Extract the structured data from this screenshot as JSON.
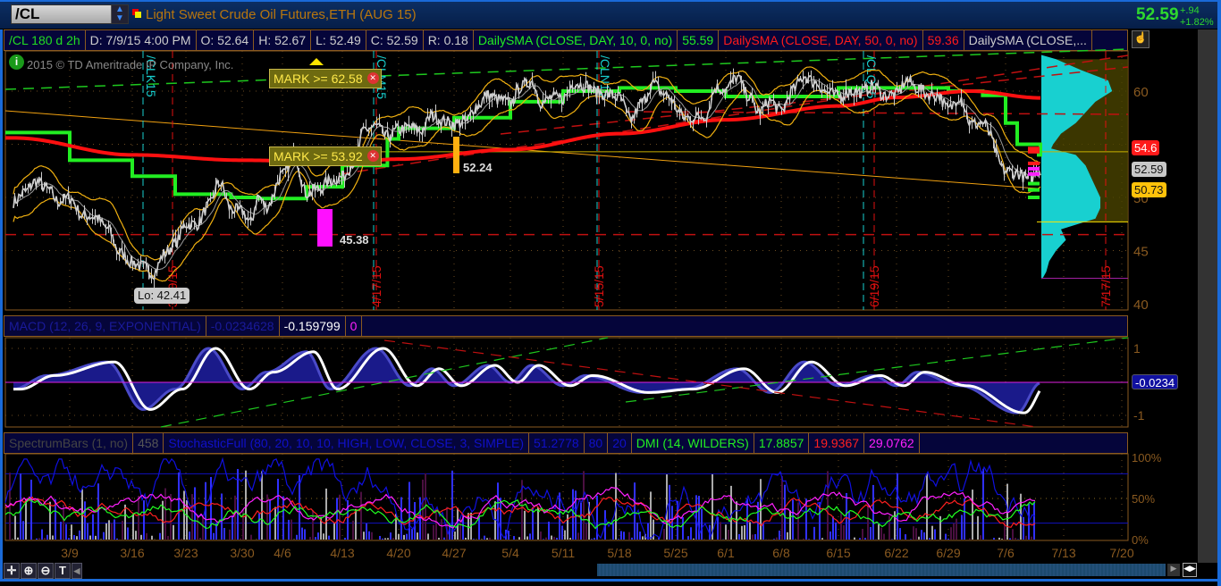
{
  "header": {
    "symbol": "/CL",
    "description": "Light Sweet Crude Oil Futures,ETH (AUG 15)",
    "last": "52.59",
    "change": "+.94",
    "change_pct": "+1.82%"
  },
  "study_row": {
    "aggregation": "/CL 180 d 2h",
    "date": "D: 7/9/15 4:00 PM",
    "open": "O: 52.64",
    "high": "H: 52.67",
    "low": "L: 52.49",
    "close": "C: 52.59",
    "range": "R: 0.18",
    "sma10_label": "DailySMA (CLOSE, DAY, 10, 0, no)",
    "sma10_value": "55.59",
    "sma50_label": "DailySMA (CLOSE, DAY, 50, 0, no)",
    "sma50_value": "59.36",
    "sma3_label": "DailySMA (CLOSE,..."
  },
  "copyright": "2015 © TD Ameritrade IP Company, Inc.",
  "alerts": [
    {
      "label": "MARK >= 62.58"
    },
    {
      "label": "MARK >= 53.92"
    }
  ],
  "annotations": {
    "low_label": "Lo: 42.41",
    "magenta_value": "45.38",
    "orange_value": "52.24"
  },
  "price_labels": [
    {
      "value": "54.6",
      "color": "#ff1a1a"
    },
    {
      "value": "52.59",
      "color": "#c8c8c8"
    },
    {
      "value": "50.73",
      "color": "#ffc20a"
    }
  ],
  "macd_header": {
    "label": "MACD (12, 26, 9, EXPONENTIAL)",
    "value": "-0.0234628",
    "avg": "-0.159799",
    "diff": "0",
    "last_label": "-0.0234"
  },
  "lower_header": {
    "spectrum": "SpectrumBars (1, no)",
    "spectrum_value": "458",
    "stoch": "StochasticFull (80, 20, 10, 10, HIGH, LOW, CLOSE, 3, SIMPLE)",
    "stoch_value": "51.2778",
    "ob": "80",
    "os": "20",
    "dmi": "DMI (14, WILDERS)",
    "dmi_adx": "17.8857",
    "dmi_minus": "19.9367",
    "dmi_plus": "29.0762"
  },
  "colors": {
    "price": "#d0d0d0",
    "sma10": "#22ee22",
    "sma50": "#ff1010",
    "band": "#f0b010",
    "profile": "#18d0d0",
    "macd_fill": "#1a1a8a",
    "stoch": "#1010e0",
    "dmi_plus": "#ff20ff",
    "dmi_minus": "#ff2020",
    "adx": "#20ff20"
  },
  "icons": {
    "crosshair": "crosshair-icon",
    "zoom_in": "zoom-in-icon",
    "zoom_out": "zoom-out-icon",
    "text": "text-tool-icon"
  },
  "chart_data": {
    "type": "line",
    "price_axis": {
      "ticks": [
        "60",
        "50",
        "45",
        "40"
      ],
      "range": [
        40,
        63
      ]
    },
    "date_axis": {
      "ticks": [
        "3/9",
        "3/16",
        "3/23",
        "3/30",
        "4/6",
        "4/13",
        "4/20",
        "4/27",
        "5/4",
        "5/11",
        "5/18",
        "5/25",
        "6/1",
        "6/8",
        "6/15",
        "6/22",
        "6/29",
        "7/6",
        "7/13",
        "7/20"
      ]
    },
    "expiry_markers": [
      {
        "symbol": "/CLK15",
        "date": "3/20/15"
      },
      {
        "symbol": "/CLM15",
        "date": "4/17/15"
      },
      {
        "symbol": "/CLN15",
        "date": "5/15/15"
      },
      {
        "symbol": "/CLQ15",
        "date": "6/19/15"
      },
      {
        "symbol": "",
        "date": "7/17/15"
      }
    ],
    "close": [
      [
        "3/2",
        49.6
      ],
      [
        "3/3",
        50.5
      ],
      [
        "3/4",
        51.5
      ],
      [
        "3/5",
        50.8
      ],
      [
        "3/6",
        49.6
      ],
      [
        "3/9",
        50.0
      ],
      [
        "3/10",
        48.3
      ],
      [
        "3/11",
        48.2
      ],
      [
        "3/12",
        47.1
      ],
      [
        "3/13",
        44.8
      ],
      [
        "3/16",
        43.9
      ],
      [
        "3/17",
        43.5
      ],
      [
        "3/18",
        42.9
      ],
      [
        "3/19",
        44.7
      ],
      [
        "3/20",
        45.7
      ],
      [
        "3/23",
        47.5
      ],
      [
        "3/24",
        47.5
      ],
      [
        "3/25",
        49.2
      ],
      [
        "3/26",
        51.4
      ],
      [
        "3/27",
        48.9
      ],
      [
        "3/30",
        48.7
      ],
      [
        "3/31",
        47.6
      ],
      [
        "4/1",
        50.1
      ],
      [
        "4/2",
        49.1
      ],
      [
        "4/6",
        52.1
      ],
      [
        "4/7",
        53.9
      ],
      [
        "4/8",
        50.4
      ],
      [
        "4/9",
        50.8
      ],
      [
        "4/10",
        51.6
      ],
      [
        "4/13",
        51.9
      ],
      [
        "4/14",
        53.3
      ],
      [
        "4/15",
        56.4
      ],
      [
        "4/16",
        56.7
      ],
      [
        "4/17",
        55.7
      ],
      [
        "4/20",
        56.4
      ],
      [
        "4/21",
        56.6
      ],
      [
        "4/22",
        56.2
      ],
      [
        "4/23",
        57.7
      ],
      [
        "4/24",
        57.2
      ],
      [
        "4/27",
        56.9
      ],
      [
        "4/28",
        57.1
      ],
      [
        "4/29",
        58.6
      ],
      [
        "4/30",
        59.6
      ],
      [
        "5/1",
        59.2
      ],
      [
        "5/4",
        58.9
      ],
      [
        "5/5",
        60.4
      ],
      [
        "5/6",
        60.9
      ],
      [
        "5/7",
        58.9
      ],
      [
        "5/8",
        59.4
      ],
      [
        "5/11",
        59.3
      ],
      [
        "5/12",
        60.8
      ],
      [
        "5/13",
        60.5
      ],
      [
        "5/14",
        59.9
      ],
      [
        "5/15",
        59.7
      ],
      [
        "5/18",
        59.4
      ],
      [
        "5/19",
        57.3
      ],
      [
        "5/20",
        58.9
      ],
      [
        "5/21",
        60.7
      ],
      [
        "5/22",
        59.7
      ],
      [
        "5/26",
        57.5
      ],
      [
        "5/27",
        57.5
      ],
      [
        "5/28",
        57.7
      ],
      [
        "5/29",
        60.3
      ],
      [
        "6/1",
        60.2
      ],
      [
        "6/2",
        61.3
      ],
      [
        "6/3",
        59.6
      ],
      [
        "6/4",
        58.0
      ],
      [
        "6/5",
        59.1
      ],
      [
        "6/8",
        58.1
      ],
      [
        "6/9",
        60.1
      ],
      [
        "6/10",
        61.4
      ],
      [
        "6/11",
        60.8
      ],
      [
        "6/12",
        59.9
      ],
      [
        "6/15",
        59.5
      ],
      [
        "6/16",
        60.0
      ],
      [
        "6/17",
        59.9
      ],
      [
        "6/18",
        60.5
      ],
      [
        "6/19",
        59.6
      ],
      [
        "6/22",
        59.7
      ],
      [
        "6/23",
        61.0
      ],
      [
        "6/24",
        60.3
      ],
      [
        "6/25",
        59.7
      ],
      [
        "6/26",
        59.6
      ],
      [
        "6/29",
        58.3
      ],
      [
        "6/30",
        59.5
      ],
      [
        "7/1",
        56.9
      ],
      [
        "7/2",
        57.0
      ],
      [
        "7/6",
        52.5
      ],
      [
        "7/7",
        52.3
      ],
      [
        "7/8",
        51.7
      ],
      [
        "7/9",
        52.59
      ]
    ],
    "sma10": [
      [
        "3/2",
        56.1
      ],
      [
        "3/9",
        53.5
      ],
      [
        "3/16",
        52.0
      ],
      [
        "3/20",
        50.3
      ],
      [
        "3/27",
        50.0
      ],
      [
        "4/1",
        49.9
      ],
      [
        "4/8",
        51.0
      ],
      [
        "4/13",
        53.0
      ],
      [
        "4/17",
        55.5
      ],
      [
        "4/20",
        56.5
      ],
      [
        "4/27",
        57.5
      ],
      [
        "5/4",
        59.0
      ],
      [
        "5/11",
        60.0
      ],
      [
        "5/18",
        60.3
      ],
      [
        "5/25",
        60.0
      ],
      [
        "6/1",
        59.5
      ],
      [
        "6/8",
        59.5
      ],
      [
        "6/15",
        60.3
      ],
      [
        "6/22",
        60.3
      ],
      [
        "6/29",
        60.0
      ],
      [
        "7/2",
        59.6
      ],
      [
        "7/6",
        57.0
      ],
      [
        "7/7",
        55.0
      ],
      [
        "7/9",
        54.0
      ]
    ],
    "sma50": [
      [
        "3/2",
        55.6
      ],
      [
        "3/16",
        54.0
      ],
      [
        "3/30",
        53.5
      ],
      [
        "4/13",
        53.3
      ],
      [
        "4/20",
        53.6
      ],
      [
        "5/4",
        54.5
      ],
      [
        "5/18",
        56.0
      ],
      [
        "6/1",
        57.3
      ],
      [
        "6/15",
        58.6
      ],
      [
        "6/22",
        59.4
      ],
      [
        "7/1",
        60.0
      ],
      [
        "7/9",
        59.36
      ]
    ],
    "macd": [
      [
        "3/2",
        -0.2
      ],
      [
        "3/5",
        0.2
      ],
      [
        "3/12",
        0.6
      ],
      [
        "3/17",
        -0.8
      ],
      [
        "3/20",
        -0.2
      ],
      [
        "3/25",
        1.0
      ],
      [
        "3/30",
        -0.2
      ],
      [
        "4/2",
        0.3
      ],
      [
        "4/8",
        0.9
      ],
      [
        "4/10",
        -0.2
      ],
      [
        "4/16",
        1.0
      ],
      [
        "4/21",
        -0.1
      ],
      [
        "4/23",
        0.4
      ],
      [
        "4/27",
        -0.1
      ],
      [
        "4/30",
        0.5
      ],
      [
        "5/4",
        0.0
      ],
      [
        "5/6",
        0.5
      ],
      [
        "5/11",
        -0.1
      ],
      [
        "5/13",
        0.2
      ],
      [
        "5/20",
        -0.3
      ],
      [
        "5/26",
        -0.2
      ],
      [
        "6/2",
        0.4
      ],
      [
        "6/5",
        -0.3
      ],
      [
        "6/10",
        0.6
      ],
      [
        "6/15",
        -0.1
      ],
      [
        "6/18",
        0.2
      ],
      [
        "6/22",
        -0.1
      ],
      [
        "6/24",
        0.3
      ],
      [
        "6/30",
        -0.1
      ],
      [
        "7/7",
        -0.9
      ],
      [
        "7/9",
        -0.02
      ]
    ],
    "macd_axis": {
      "ticks": [
        "1",
        "-1"
      ]
    },
    "lower_axis": {
      "ticks": [
        "100%",
        "50%",
        "0%"
      ]
    },
    "volume_profile": [
      [
        42.5,
        2
      ],
      [
        43,
        5
      ],
      [
        44,
        8
      ],
      [
        45,
        15
      ],
      [
        46,
        25
      ],
      [
        47,
        20
      ],
      [
        48,
        55
      ],
      [
        49,
        60
      ],
      [
        50,
        60
      ],
      [
        51,
        55
      ],
      [
        52,
        50
      ],
      [
        53,
        45
      ],
      [
        54,
        35
      ],
      [
        54.6,
        10
      ],
      [
        55,
        12
      ],
      [
        56,
        20
      ],
      [
        57,
        35
      ],
      [
        58,
        45
      ],
      [
        59,
        55
      ],
      [
        60,
        72
      ],
      [
        61,
        68
      ],
      [
        62,
        40
      ],
      [
        63,
        15
      ]
    ]
  }
}
